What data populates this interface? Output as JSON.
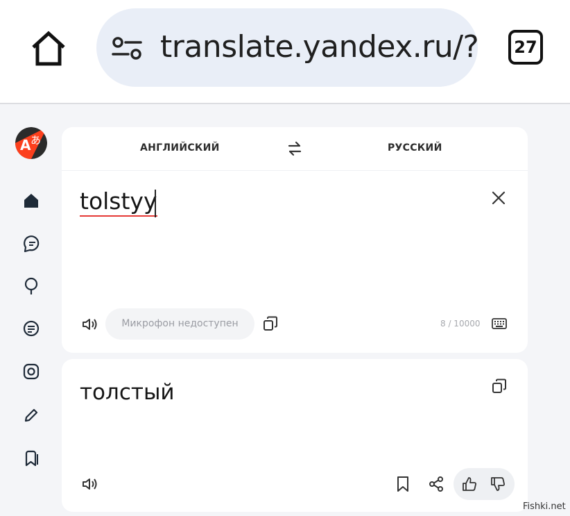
{
  "browser": {
    "url": "translate.yandex.ru/?",
    "tab_count": "27"
  },
  "translator": {
    "source_lang": "АНГЛИЙСКИЙ",
    "target_lang": "РУССКИЙ",
    "source_text": "tolstyy",
    "mic_label": "Микрофон недоступен",
    "char_counter": "8 / 10000",
    "translation": "толстый"
  },
  "watermark": "Fishki.net",
  "icons": {
    "rail": [
      "home-icon",
      "chat-icon",
      "lightbulb-icon",
      "document-icon",
      "camera-icon",
      "pencil-icon",
      "bookmarks-icon"
    ]
  },
  "colors": {
    "accent_red": "#e53935",
    "logo_red": "#fc3f1d",
    "logo_dark": "#2b2b2b",
    "url_bar_bg": "#e9eef7"
  }
}
